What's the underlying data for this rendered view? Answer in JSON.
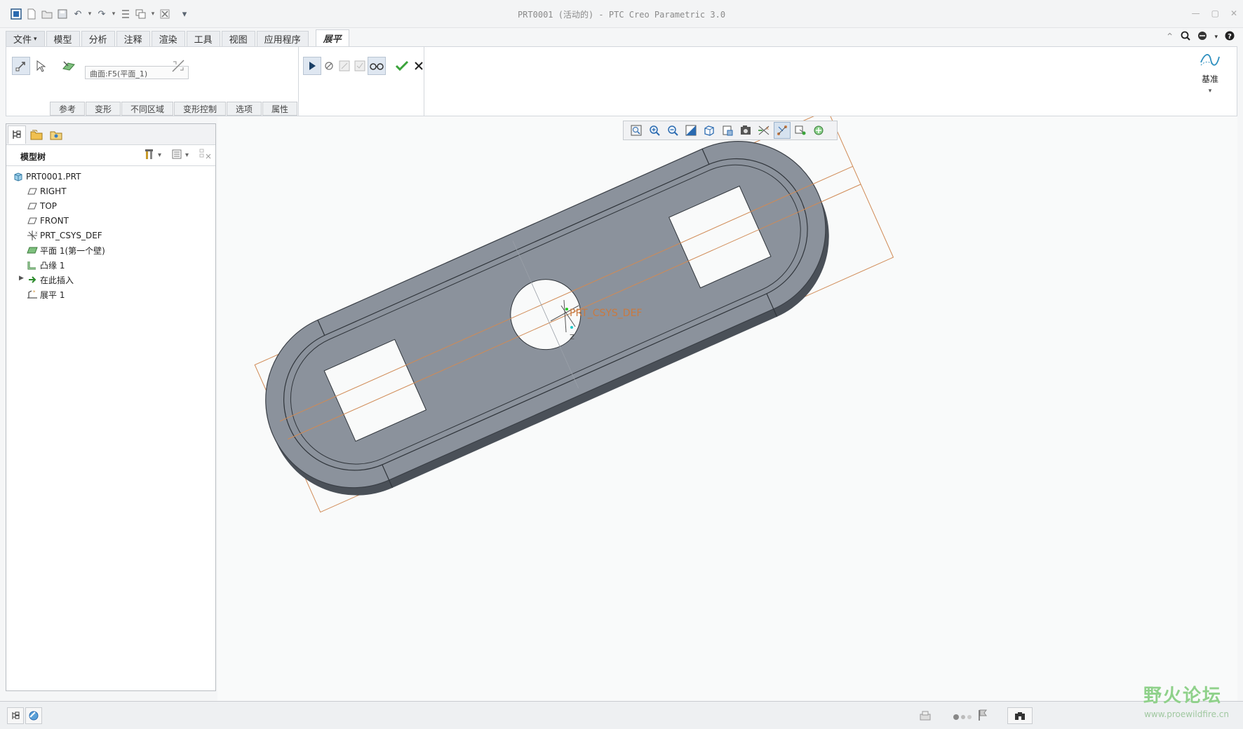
{
  "window": {
    "title": "PRT0001 (活动的) - PTC Creo Parametric 3.0"
  },
  "menu": {
    "tabs": [
      "文件",
      "模型",
      "分析",
      "注释",
      "渲染",
      "工具",
      "视图",
      "应用程序"
    ],
    "active_tab": "展平"
  },
  "ribbon": {
    "surface_field": "曲面:F5(平面_1)",
    "subtabs": [
      "参考",
      "变形",
      "不同区域",
      "变形控制",
      "选项",
      "属性"
    ],
    "datum_label": "基准"
  },
  "model_tree": {
    "title": "模型树",
    "items": [
      {
        "label": "PRT0001.PRT",
        "icon": "part-icon"
      },
      {
        "label": "RIGHT",
        "icon": "datum-plane-icon"
      },
      {
        "label": "TOP",
        "icon": "datum-plane-icon"
      },
      {
        "label": "FRONT",
        "icon": "datum-plane-icon"
      },
      {
        "label": "PRT_CSYS_DEF",
        "icon": "csys-icon"
      },
      {
        "label": "平面 1(第一个壁)",
        "icon": "flat-wall-icon"
      },
      {
        "label": "凸缘 1",
        "icon": "flange-icon"
      },
      {
        "label": "在此插入",
        "icon": "insert-here-icon"
      },
      {
        "label": "展平 1",
        "icon": "flatten-icon"
      }
    ]
  },
  "viewport": {
    "csys_label": "PRT_CSYS_DEF",
    "axis_label": "Z"
  },
  "watermark": {
    "text": "野火论坛",
    "url": "www.proewildfire.cn"
  },
  "colors": {
    "part_face": "#8b929c",
    "part_dark": "#4a5058",
    "datum_orange": "#d08a55",
    "accept_green": "#3aa33a"
  }
}
